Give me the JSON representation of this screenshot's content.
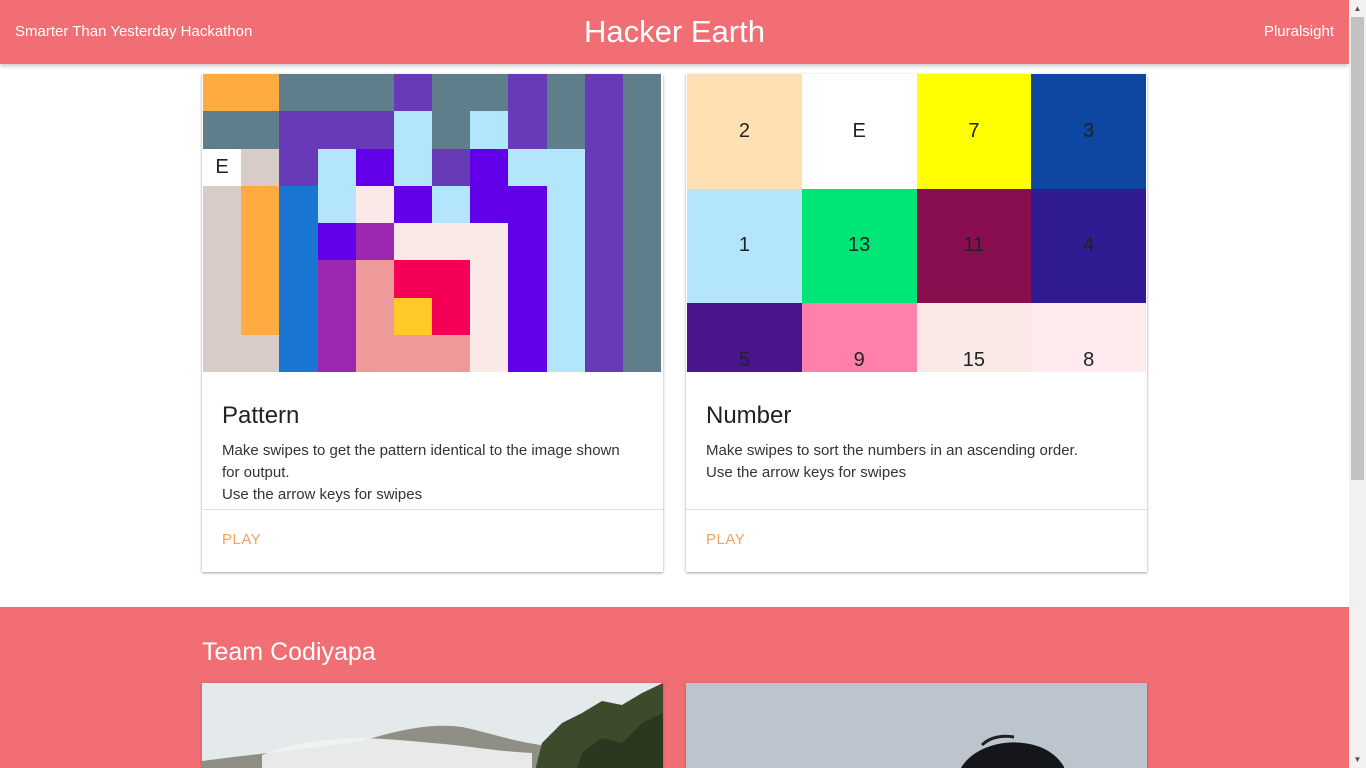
{
  "header": {
    "left_link": "Smarter Than Yesterday Hackathon",
    "title": "Hacker Earth",
    "right_link": "Pluralsight",
    "background_color": "#f06e74"
  },
  "cards": [
    {
      "title": "Pattern",
      "description_lines": [
        "Make swipes to get the pattern identical to the image shown",
        "for output.",
        "Use the arrow keys for swipes"
      ],
      "action_label": "PLAY",
      "tile_grid": {
        "rows": [
          [
            "#ffab40",
            "#ffab40",
            "#607d8b",
            "#607d8b",
            "#607d8b",
            "#673ab7",
            "#607d8b",
            "#607d8b",
            "#673ab7",
            "#607d8b",
            "#673ab7",
            "#607d8b"
          ],
          [
            "#607d8b",
            "#607d8b",
            "#673ab7",
            "#673ab7",
            "#673ab7",
            "#b3e5fc",
            "#607d8b",
            "#b3e5fc",
            "#673ab7",
            "#607d8b",
            "#673ab7",
            "#607d8b"
          ],
          [
            "#ffffff",
            "#d7ccc8",
            "#673ab7",
            "#b3e5fc",
            "#6200ea",
            "#b3e5fc",
            "#673ab7",
            "#6200ea",
            "#b3e5fc",
            "#b3e5fc",
            "#673ab7",
            "#607d8b"
          ],
          [
            "#d7ccc8",
            "#ffab40",
            "#1976d2",
            "#b3e5fc",
            "#fbe9e7",
            "#6200ea",
            "#b3e5fc",
            "#6200ea",
            "#6200ea",
            "#b3e5fc",
            "#673ab7",
            "#607d8b"
          ],
          [
            "#d7ccc8",
            "#ffab40",
            "#1976d2",
            "#6200ea",
            "#9c27b0",
            "#fbe9e7",
            "#fbe9e7",
            "#fbe9e7",
            "#6200ea",
            "#b3e5fc",
            "#673ab7",
            "#607d8b"
          ],
          [
            "#d7ccc8",
            "#ffab40",
            "#1976d2",
            "#9c27b0",
            "#ef9a9a",
            "#f50057",
            "#f50057",
            "#fbe9e7",
            "#6200ea",
            "#b3e5fc",
            "#673ab7",
            "#607d8b"
          ],
          [
            "#d7ccc8",
            "#ffab40",
            "#1976d2",
            "#9c27b0",
            "#ef9a9a",
            "#ffca28",
            "#f50057",
            "#fbe9e7",
            "#6200ea",
            "#b3e5fc",
            "#673ab7",
            "#607d8b"
          ],
          [
            "#d7ccc8",
            "#d7ccc8",
            "#1976d2",
            "#9c27b0",
            "#ef9a9a",
            "#ef9a9a",
            "#ef9a9a",
            "#fbe9e7",
            "#6200ea",
            "#b3e5fc",
            "#673ab7",
            "#607d8b"
          ]
        ],
        "empty_tile": {
          "row": 2,
          "col": 0,
          "label": "E"
        }
      }
    },
    {
      "title": "Number",
      "description_lines": [
        "Make swipes to sort the numbers in an ascending order.",
        "Use the arrow keys for swipes"
      ],
      "action_label": "PLAY",
      "tiles": [
        {
          "label": "2",
          "color": "#ffe0b2"
        },
        {
          "label": "E",
          "color": "#ffffff"
        },
        {
          "label": "7",
          "color": "#ffff00"
        },
        {
          "label": "3",
          "color": "#0d47a1"
        },
        {
          "label": "1",
          "color": "#b3e5fc"
        },
        {
          "label": "13",
          "color": "#00e676"
        },
        {
          "label": "11",
          "color": "#880e4f"
        },
        {
          "label": "4",
          "color": "#311b92"
        },
        {
          "label": "5",
          "color": "#4a148c"
        },
        {
          "label": "9",
          "color": "#ff80ab"
        },
        {
          "label": "15",
          "color": "#fbe9e7"
        },
        {
          "label": "8",
          "color": "#ffebee"
        }
      ]
    }
  ],
  "team": {
    "title": "Team Codiyapa"
  },
  "colors": {
    "accent": "#f06e74",
    "action": "#f5a25d"
  }
}
